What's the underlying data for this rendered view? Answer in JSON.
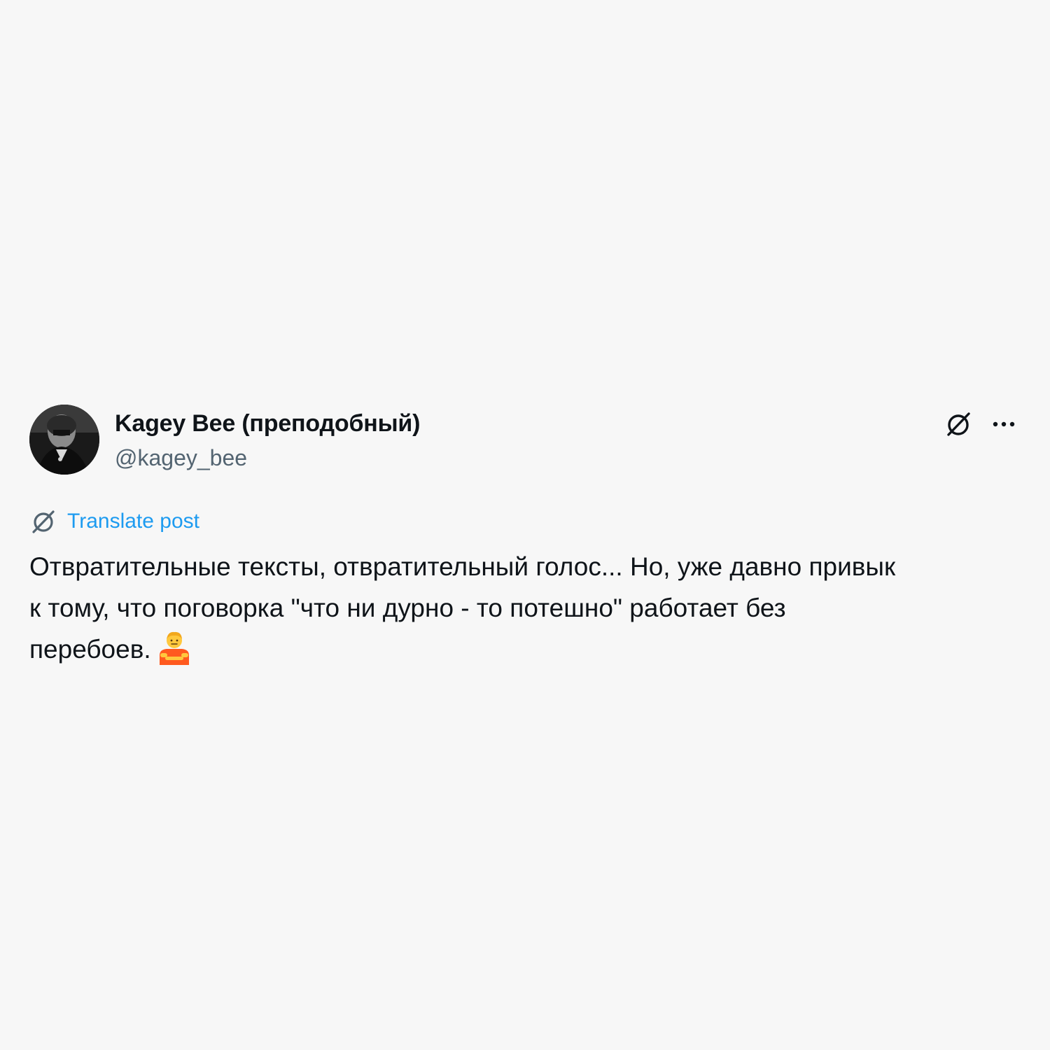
{
  "author": {
    "display_name": "Kagey Bee (преподобный)",
    "handle": "@kagey_bee"
  },
  "actions": {
    "grok_icon": "grok-icon",
    "more_icon": "more-horizontal-icon"
  },
  "translate": {
    "icon": "grok-icon",
    "label": "Translate post"
  },
  "post": {
    "lines": [
      "Отвратительные тексты, отвратительный голос... Но, уже давно привык",
      "к тому, что поговорка \"что ни дурно - то потешно\" работает без",
      "перебоев."
    ],
    "emoji": "person-shrugging-emoji"
  },
  "colors": {
    "background": "#f7f7f7",
    "text": "#0f1419",
    "secondary": "#536471",
    "accent": "#1d9bf0",
    "emoji_shirt": "#ff5a1f",
    "emoji_skin": "#ffc83d"
  }
}
